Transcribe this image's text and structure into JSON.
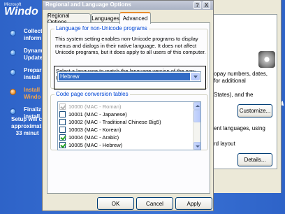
{
  "setup": {
    "logo_small": "Microsoft",
    "logo_text": "Windo",
    "steps": [
      {
        "label": "Collect\ninform",
        "state": "done"
      },
      {
        "label": "Dynam\nUpdate",
        "state": "done"
      },
      {
        "label": "Prepar\ninstall",
        "state": "done"
      },
      {
        "label": "Install\nWindo",
        "state": "active"
      },
      {
        "label": "Finaliz\ninstall",
        "state": "pending"
      }
    ],
    "time_note": "Setup will c\napproximat\n   33 minut"
  },
  "back_dialog": {
    "text_lines": [
      "opay numbers, dates,",
      "for additional",
      "",
      "States), and the"
    ],
    "customize_label": "Customize...",
    "text_lines_2": [
      "ent languages, using",
      "",
      "rd layout"
    ],
    "details_label": "Details..."
  },
  "dialog": {
    "title": "Regional and Language Options",
    "help_glyph": "?",
    "close_glyph": "X",
    "tabs": [
      {
        "label": "Regional Options",
        "selected": false
      },
      {
        "label": "Languages",
        "selected": false
      },
      {
        "label": "Advanced",
        "selected": true
      }
    ],
    "group1": {
      "legend": "Language for non-Unicode programs",
      "description": "This system setting enables non-Unicode programs to display menus and dialogs in their native language. It does not affect Unicode programs, but it does apply to all users of this computer.",
      "select_prompt": "Select a language to match the language version of the non-Unicode programs you want to use:",
      "selected_language": "Hebrew"
    },
    "group2": {
      "legend": "Code page conversion tables",
      "items": [
        {
          "label": "10000 (MAC - Roman)",
          "checked": true,
          "disabled": true
        },
        {
          "label": "10001 (MAC - Japanese)",
          "checked": false,
          "disabled": false
        },
        {
          "label": "10002 (MAC - Traditional Chinese Big5)",
          "checked": false,
          "disabled": false
        },
        {
          "label": "10003 (MAC - Korean)",
          "checked": false,
          "disabled": false
        },
        {
          "label": "10004 (MAC - Arabic)",
          "checked": true,
          "disabled": false
        },
        {
          "label": "10005 (MAC - Hebrew)",
          "checked": true,
          "disabled": false
        }
      ]
    },
    "buttons": {
      "ok": "OK",
      "cancel": "Cancel",
      "apply": "Apply"
    }
  }
}
